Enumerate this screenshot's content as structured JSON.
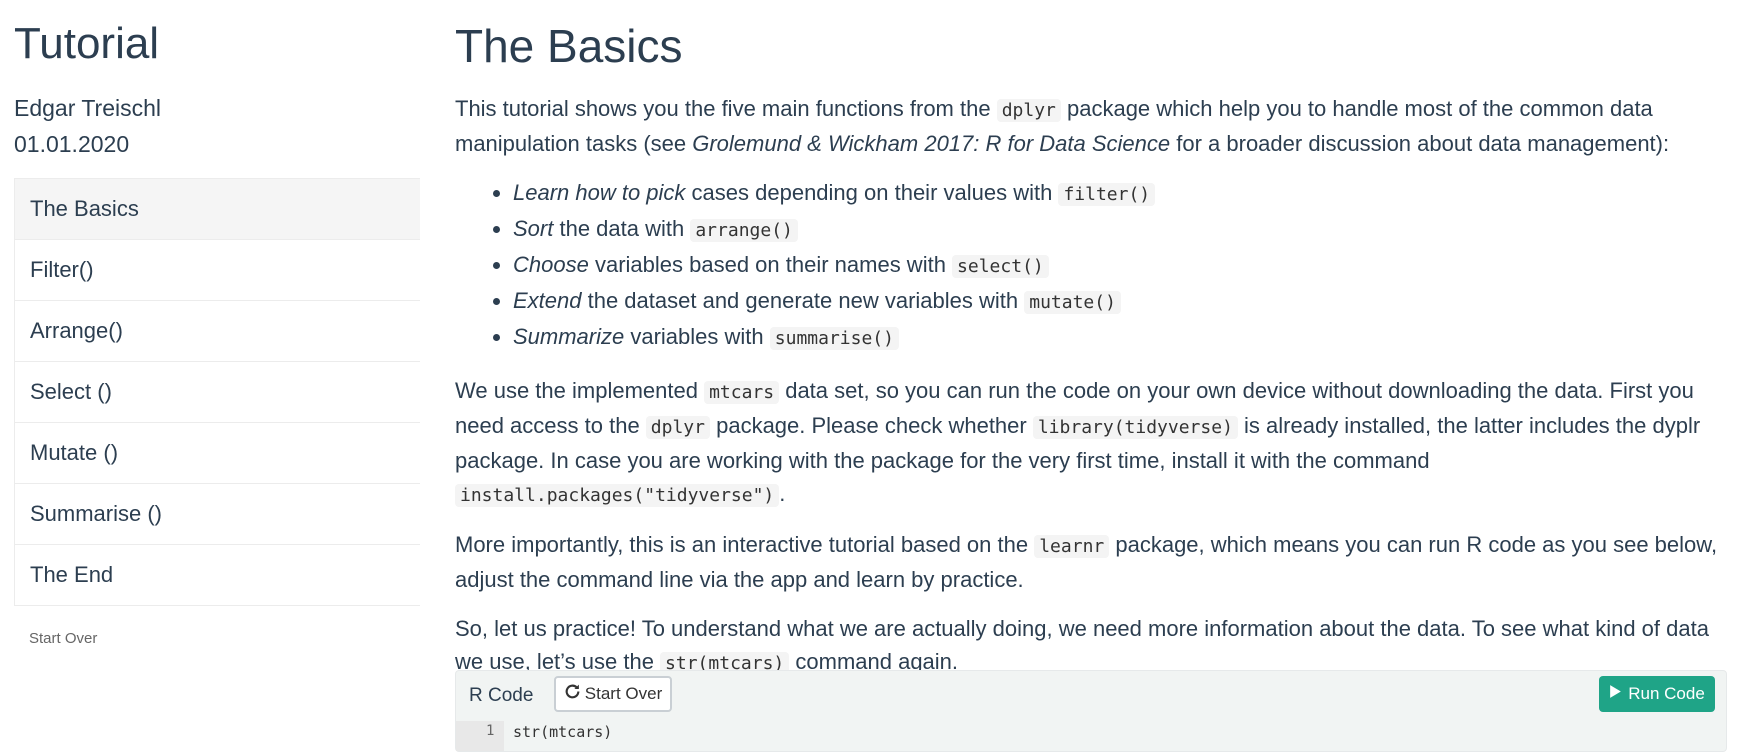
{
  "sidebar": {
    "title": "Tutorial",
    "author": "Edgar Treischl",
    "date": "01.01.2020",
    "items": [
      {
        "label": "The Basics"
      },
      {
        "label": "Filter()"
      },
      {
        "label": "Arrange()"
      },
      {
        "label": "Select ()"
      },
      {
        "label": "Mutate ()"
      },
      {
        "label": "Summarise ()"
      },
      {
        "label": "The End"
      }
    ],
    "start_over": "Start Over"
  },
  "main": {
    "title": "The Basics",
    "intro": {
      "t1": "This tutorial shows you the five main functions from the ",
      "c1": "dplyr",
      "t2": " package which help you to handle most of the common data manipulation tasks (see ",
      "em": "Grolemund & Wickham 2017: R for Data Science",
      "t3": " for a broader discussion about data management):"
    },
    "bullets": [
      {
        "em": "Learn how to pick",
        "text": " cases depending on their values with ",
        "code": "filter()"
      },
      {
        "em": "Sort",
        "text": " the data with ",
        "code": "arrange()"
      },
      {
        "em": "Choose",
        "text": " variables based on their names with ",
        "code": "select()"
      },
      {
        "em": "Extend",
        "text": " the dataset and generate new variables with ",
        "code": "mutate()"
      },
      {
        "em": "Summarize",
        "text": " variables with ",
        "code": "summarise()"
      }
    ],
    "p2": {
      "t1": "We use the implemented ",
      "c1": "mtcars",
      "t2": " data set, so you can run the code on your own device without downloading the data. First you need access to the ",
      "c2": "dplyr",
      "t3": " package. Please check whether ",
      "c3": "library(tidyverse)",
      "t4": " is already installed, the latter includes the dyplr package. In case you are working with the package for the very first time, install it with the command ",
      "c4": "install.packages(\"tidyverse\")",
      "t5": "."
    },
    "p3": {
      "t1": "More importantly, this is an interactive tutorial based on the ",
      "c1": "learnr",
      "t2": " package, which means you can run R code as you see below, adjust the command line via the app and learn by practice."
    },
    "p4": {
      "t1": "So, let us practice! To understand what we are actually doing, we need more information about the data. To see what kind of data we use, let’s use the ",
      "c1": "str(mtcars)",
      "t2": " command again."
    }
  },
  "code_panel": {
    "label": "R Code",
    "start_over": "Start Over",
    "run": "Run Code",
    "line_number": "1",
    "code": "str(mtcars)"
  },
  "colors": {
    "accent": "#1fa487",
    "text": "#2c3e50"
  }
}
